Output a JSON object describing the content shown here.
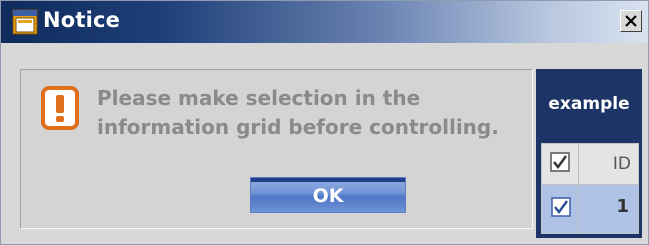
{
  "window": {
    "title": "Notice",
    "icon": "window-app-icon",
    "close_icon": "close-icon"
  },
  "message": {
    "icon": "warning-exclamation-icon",
    "line1": "Please make selection in the",
    "line2": "information grid before controlling."
  },
  "buttons": {
    "ok_label": "OK"
  },
  "example": {
    "label": "example",
    "grid": {
      "columns": [
        {
          "name": "select",
          "header_checked": true
        },
        {
          "name": "ID",
          "label": "ID"
        }
      ],
      "rows": [
        {
          "checked": true,
          "id": "1"
        }
      ]
    }
  },
  "colors": {
    "titlebar_dark": "#0f2b5c",
    "warning_orange": "#e0701c",
    "ok_button": "#6f93d6",
    "example_panel": "#1d3466",
    "selected_row": "#aec2e6"
  }
}
